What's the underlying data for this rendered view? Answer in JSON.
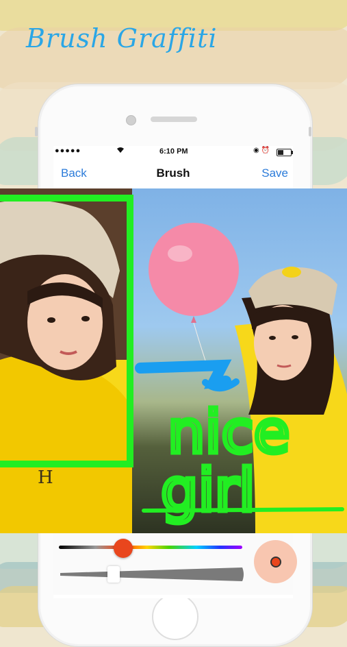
{
  "promo": {
    "title": "Brush Graffiti"
  },
  "status_bar": {
    "signal": "●●●●●",
    "wifi_icon": "wifi-icon",
    "time": "6:10 PM",
    "icons": "◉ ⏰"
  },
  "nav": {
    "back_label": "Back",
    "title": "Brush",
    "save_label": "Save"
  },
  "graffiti": {
    "text_line1": "nice",
    "text_line2": "girl"
  },
  "brush": {
    "color": "#e9461d",
    "color_position": 0.35,
    "size_position": 0.3
  },
  "colors": {
    "accent": "#2b7bd9",
    "graffiti_green": "#22ee22",
    "graffiti_blue": "#1a9ef0"
  }
}
